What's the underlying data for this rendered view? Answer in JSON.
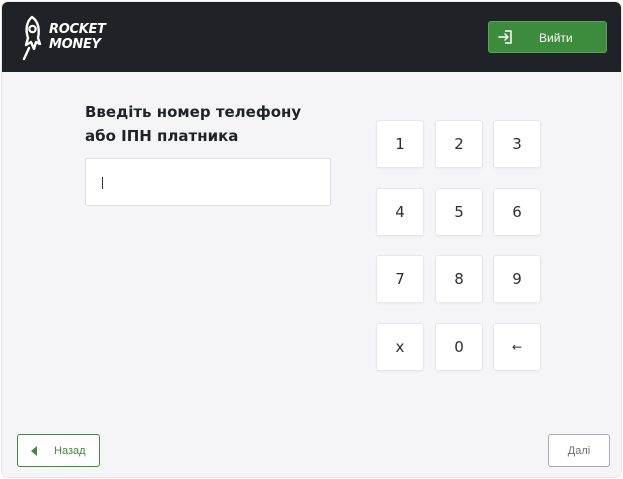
{
  "header": {
    "logo_line1": "ROCKET",
    "logo_line2": "MONEY",
    "exit_label": "Вийти"
  },
  "form": {
    "title_line1": "Введіть номер телефону",
    "title_line2": "або ІПН платника",
    "input_value": ""
  },
  "keypad": {
    "keys": [
      "1",
      "2",
      "3",
      "4",
      "5",
      "6",
      "7",
      "8",
      "9",
      "x",
      "0",
      "←"
    ]
  },
  "footer": {
    "back_label": "Назад",
    "next_label": "Далі"
  },
  "colors": {
    "header_bg": "#1f2226",
    "accent_green": "#3d8b3d",
    "page_bg": "#f5f5f7"
  },
  "icons": {
    "logo": "rocket-icon",
    "exit": "sign-in-icon",
    "back": "triangle-left-icon"
  }
}
